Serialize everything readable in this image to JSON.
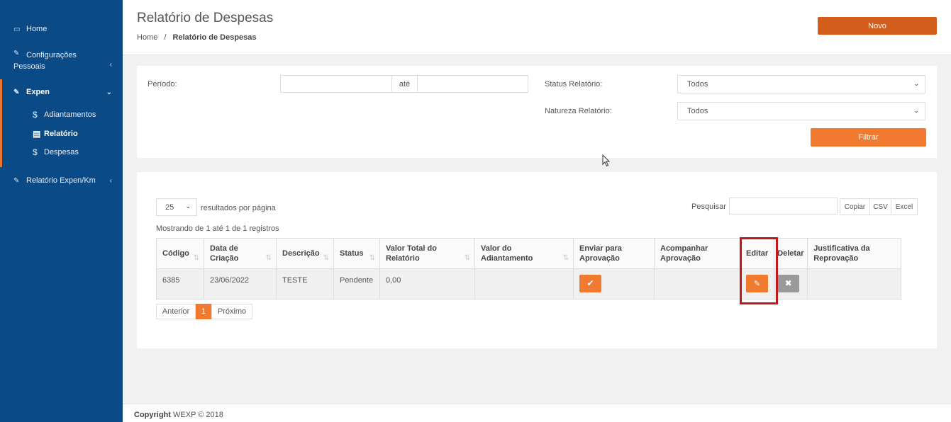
{
  "sidebar": {
    "items": [
      {
        "label": "Home",
        "icon": "laptop-icon"
      },
      {
        "label": "Configurações Pessoais",
        "icon": "edit-icon"
      },
      {
        "label": "Expen",
        "icon": "edit-icon"
      },
      {
        "label": "Relatório Expen/Km",
        "icon": "edit-icon"
      }
    ],
    "sub_items": [
      {
        "label": "Adiantamentos",
        "icon": "$"
      },
      {
        "label": "Relatório",
        "icon": "list-icon"
      },
      {
        "label": "Despesas",
        "icon": "$"
      }
    ]
  },
  "header": {
    "title": "Relatório de Despesas",
    "breadcrumb_home": "Home",
    "breadcrumb_sep": "/",
    "breadcrumb_current": "Relatório de Despesas",
    "new_button": "Novo"
  },
  "filters": {
    "periodo_label": "Período:",
    "ate_label": "até",
    "status_label": "Status Relatório:",
    "status_value": "Todos",
    "natureza_label": "Natureza Relatório:",
    "natureza_value": "Todos",
    "filter_button": "Filtrar"
  },
  "table_controls": {
    "page_size": "25",
    "per_page_label": "resultados por página",
    "search_label": "Pesquisar",
    "export_buttons": [
      "Copiar",
      "CSV",
      "Excel"
    ],
    "info": "Mostrando de 1 até 1 de 1 registros"
  },
  "table": {
    "headers": [
      "Código",
      "Data de Criação",
      "Descrição",
      "Status",
      "Valor Total do Relatório",
      "Valor do Adiantamento",
      "Enviar para Aprovação",
      "Acompanhar Aprovação",
      "Editar",
      "Deletar",
      "Justificativa da Reprovação"
    ],
    "row": {
      "codigo": "6385",
      "data": "23/06/2022",
      "descricao": "TESTE",
      "status": "Pendente",
      "valor_total": "0,00",
      "valor_adiantamento": "",
      "acompanhar": "",
      "justificativa": ""
    }
  },
  "pagination": {
    "prev": "Anterior",
    "current": "1",
    "next": "Próximo"
  },
  "footer": {
    "copyright_bold": "Copyright",
    "copyright_text": "WEXP © 2018"
  },
  "colors": {
    "sidebar": "#0a4a87",
    "accent": "#f07a30",
    "new_button": "#d35d1b",
    "highlight": "#c0181f"
  }
}
